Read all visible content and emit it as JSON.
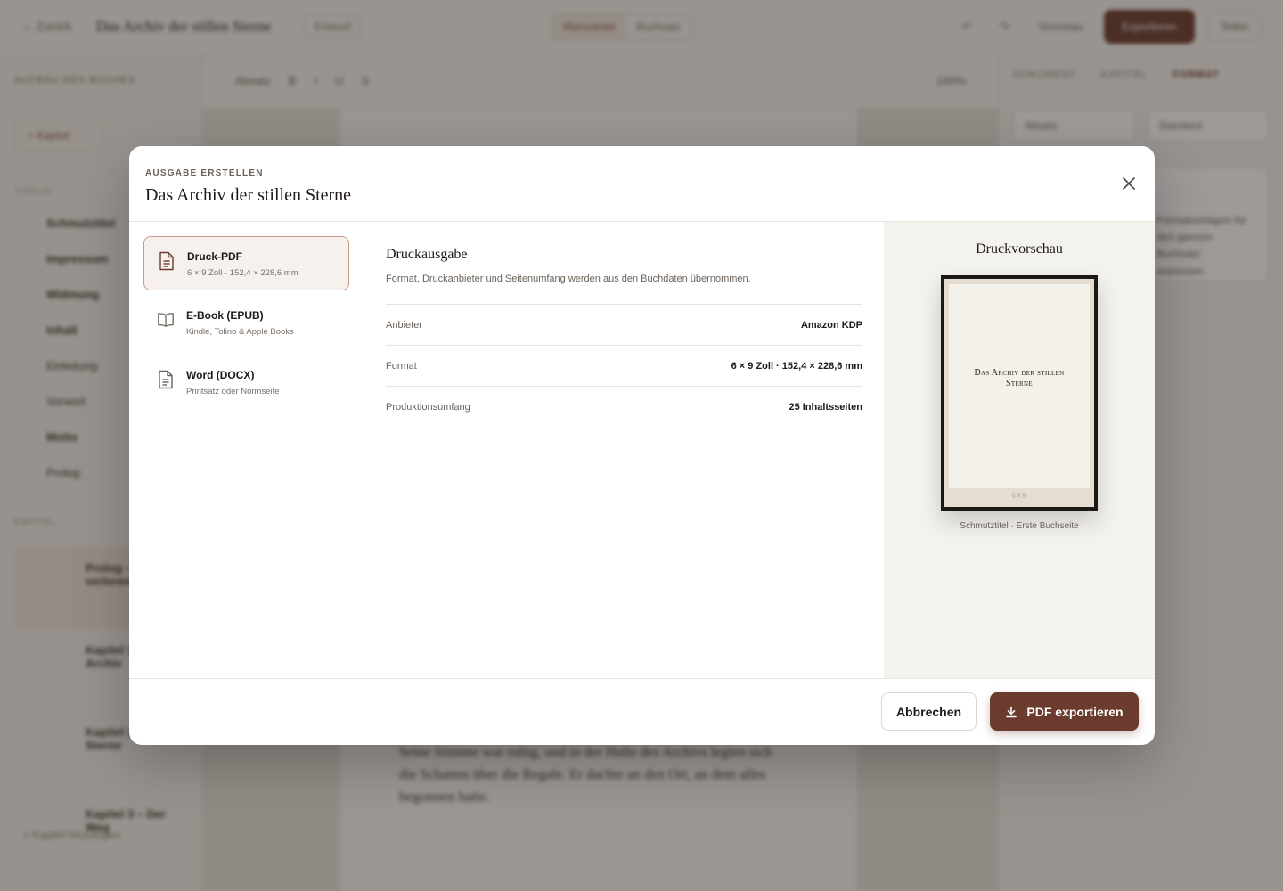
{
  "background": {
    "topbar": {
      "back": "← Zurück",
      "title": "Das Archiv der stillen Sterne",
      "chip": "Entwurf",
      "seg": [
        "Manuskript",
        "Buchsatz"
      ],
      "preview": "Vorschau",
      "export": "Exportieren",
      "share": "Teilen"
    },
    "sidebar": {
      "head": "AUFBAU DES BUCHES",
      "new_button": "+ Kapitel",
      "front_section": "TITELEI",
      "front_items": [
        "Schmutztitel",
        "Impressum",
        "Widmung",
        "Inhalt",
        "Einleitung",
        "Vorwort",
        "Motto",
        "Prolog"
      ],
      "chapter_section": "KAPITEL",
      "chapters": [
        "Prolog – Der verlorene Pfad",
        "Kapitel 1 – Das Archiv",
        "Kapitel 2 – Die Sterne",
        "Kapitel 3 – Der Weg"
      ],
      "add_chapter": "+ Kapitel hinzufügen"
    },
    "editor": {
      "toolbar": [
        "Absatz",
        "B",
        "I",
        "U",
        "S",
        "100%"
      ],
      "text": "Seine Stimme war ruhig, und in der Halle des Archivs legten sich die Schatten über die Regale. Er dachte an den Ort, an dem alles begonnen hatte."
    },
    "right_panel": {
      "tabs": [
        "DOKUMENT",
        "KAPITEL",
        "FORMAT"
      ],
      "select_a": "Absatz",
      "select_b": "Standard",
      "card_text": "Formatvorlagen für den ganzen Buchsatz anpassen."
    }
  },
  "modal": {
    "eyebrow": "AUSGABE ERSTELLEN",
    "title": "Das Archiv der stillen Sterne",
    "close_icon": "close-icon",
    "options": [
      {
        "label": "Druck-PDF",
        "sub": "6 × 9 Zoll · 152,4 × 228,6 mm",
        "icon": "document-icon",
        "selected": true
      },
      {
        "label": "E-Book (EPUB)",
        "sub": "Kindle, Tolino & Apple Books",
        "icon": "open-book-icon",
        "selected": false
      },
      {
        "label": "Word (DOCX)",
        "sub": "Printsatz oder Normseite",
        "icon": "document-icon",
        "selected": false
      }
    ],
    "detail": {
      "title": "Druckausgabe",
      "description": "Format, Druckanbieter und Seitenumfang werden aus den Buchdaten übernommen.",
      "rows": [
        {
          "key": "Anbieter",
          "value": "Amazon KDP"
        },
        {
          "key": "Format",
          "value": "6 × 9 Zoll · 152,4 × 228,6 mm"
        },
        {
          "key": "Produktionsumfang",
          "value": "25 Inhaltsseiten"
        }
      ]
    },
    "preview": {
      "title": "Druckvorschau",
      "book_title": "Das Archiv der stillen Sterne",
      "trim_label": "6X9",
      "caption": "Schmutztitel · Erste Buchseite"
    },
    "footer": {
      "cancel": "Abbrechen",
      "export": "PDF exportieren",
      "export_icon": "download-icon"
    },
    "colors": {
      "accent": "#6b3b2e",
      "selected_border": "#c69b86",
      "selected_bg": "#f6f1ec"
    }
  }
}
